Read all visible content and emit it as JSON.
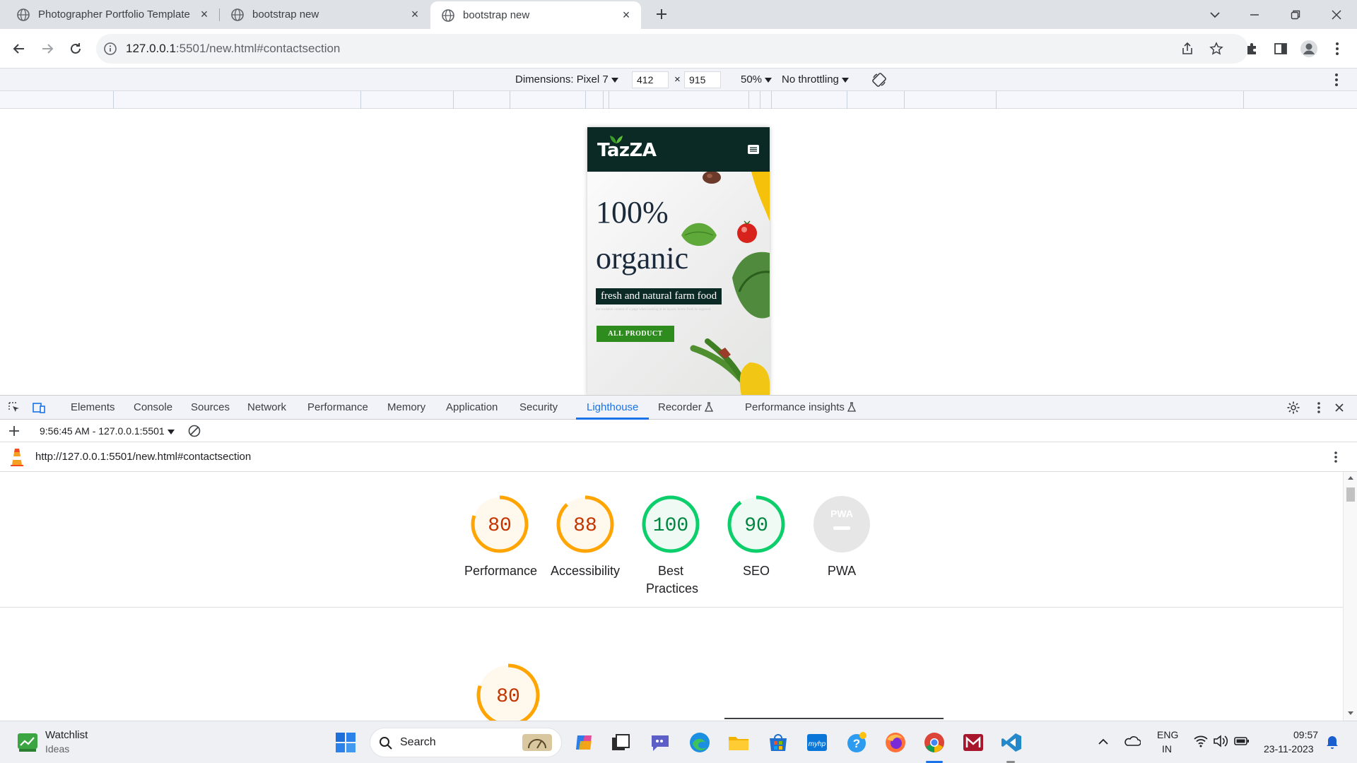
{
  "browser": {
    "tabs": [
      {
        "title": "Photographer Portfolio Template",
        "active": false
      },
      {
        "title": "bootstrap new",
        "active": false
      },
      {
        "title": "bootstrap new",
        "active": true
      }
    ],
    "url_host": "127.0.0.1",
    "url_rest": ":5501/new.html#contactsection"
  },
  "device_toolbar": {
    "dimensions_label": "Dimensions: Pixel 7",
    "width": "412",
    "height": "915",
    "times": "×",
    "zoom": "50%",
    "throttling": "No throttling"
  },
  "page": {
    "logo": "TazZA",
    "headline_1": "100%",
    "headline_2": "organic",
    "subheading": "fresh and natural farm food",
    "body": "the readable content of a page when looking at its layout. lorem fresh be ingested.",
    "button": "ALL PRODUCT"
  },
  "devtools": {
    "tabs": [
      "Elements",
      "Console",
      "Sources",
      "Network",
      "Performance",
      "Memory",
      "Application",
      "Security",
      "Lighthouse",
      "Recorder",
      "Performance insights"
    ],
    "active_tab": "Lighthouse",
    "report_selector": "9:56:45 AM - 127.0.0.1:5501",
    "report_url": "http://127.0.0.1:5501/new.html#contactsection",
    "scores": [
      {
        "label": "Performance",
        "score": 80,
        "color": "#ffa400"
      },
      {
        "label": "Accessibility",
        "score": 88,
        "color": "#ffa400"
      },
      {
        "label": "Best Practices",
        "score": 100,
        "color": "#0cce6b"
      },
      {
        "label": "SEO",
        "score": 90,
        "color": "#0cce6b"
      },
      {
        "label": "PWA",
        "score": null,
        "color": "#9aa0a6"
      }
    ],
    "large_score": 80
  },
  "taskbar": {
    "watchlist_title": "Watchlist",
    "watchlist_sub": "Ideas",
    "search_placeholder": "Search",
    "lang_1": "ENG",
    "lang_2": "IN",
    "time": "09:57",
    "date": "23-11-2023"
  }
}
